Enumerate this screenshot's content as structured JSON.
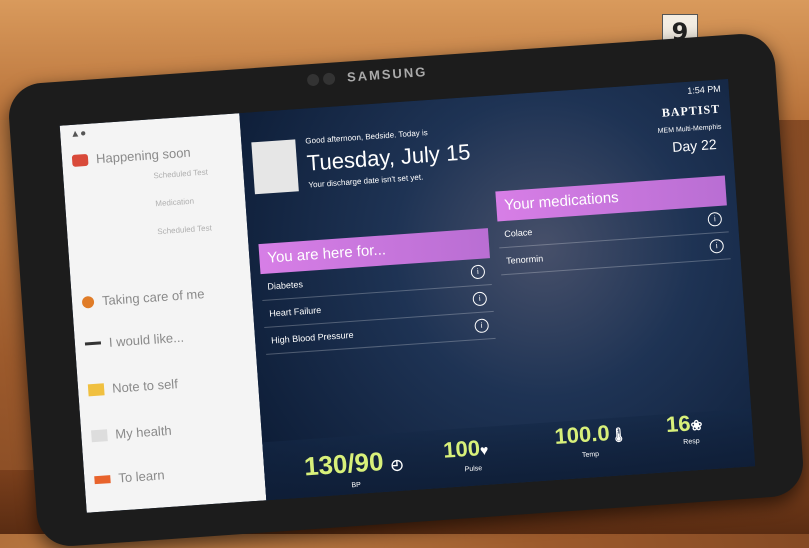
{
  "photo_label": "9",
  "device": {
    "brand": "SAMSUNG"
  },
  "status_bar": {
    "time": "1:54 PM"
  },
  "sidebar": {
    "items": [
      {
        "label": "Happening soon",
        "color": "#d94a3a"
      },
      {
        "label": "Taking care of me",
        "color": "#e07c28"
      },
      {
        "label": "I would like...",
        "color": "#333333"
      },
      {
        "label": "Note to self",
        "color": "#f0c040"
      },
      {
        "label": "My health",
        "color": "#888888"
      },
      {
        "label": "To learn",
        "color": "#e8632c"
      }
    ],
    "sub_items": [
      "Scheduled Test",
      "Medication",
      "Scheduled Test"
    ]
  },
  "header": {
    "greeting": "Good afternoon, Bedside. Today is",
    "date": "Tuesday, July 15",
    "discharge_note": "Your discharge date isn't set yet.",
    "logo": "BAPTIST",
    "unit_line": "MEM Multi-Memphis",
    "day": "Day 22"
  },
  "here_for": {
    "title": "You are here for...",
    "items": [
      "Diabetes",
      "Heart Failure",
      "High Blood Pressure"
    ]
  },
  "medications": {
    "title": "Your medications",
    "items": [
      "Colace",
      "Tenormin"
    ]
  },
  "vitals": {
    "bp": {
      "value": "130/90",
      "label": "BP"
    },
    "pulse": {
      "value": "100",
      "label": "Pulse"
    },
    "temp": {
      "value": "100.0",
      "label": "Temp"
    },
    "resp": {
      "value": "16",
      "label": "Resp"
    }
  }
}
